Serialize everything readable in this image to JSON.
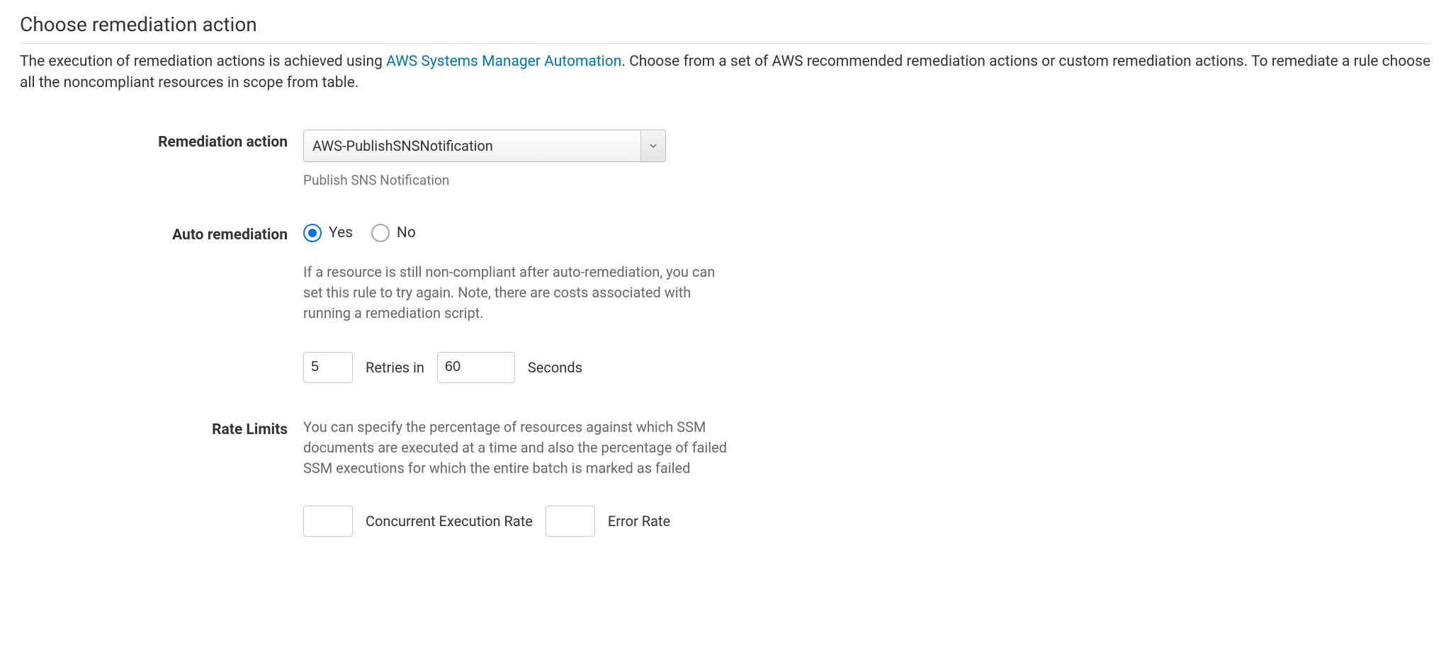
{
  "title": "Choose remediation action",
  "description": {
    "part1": "The execution of remediation actions is achieved using ",
    "link": "AWS Systems Manager Automation",
    "part2": ". Choose from a set of AWS recommended remediation actions or custom remediation actions. To remediate a rule choose all the noncompliant resources in scope from table."
  },
  "remediation": {
    "label": "Remediation action",
    "selected": "AWS-PublishSNSNotification",
    "helper": "Publish SNS Notification"
  },
  "auto": {
    "label": "Auto remediation",
    "yes": "Yes",
    "no": "No",
    "selected": "yes",
    "desc": "If a resource is still non-compliant after auto-remediation, you can set this rule to try again. Note, there are costs associated with running a remediation script.",
    "retries_value": "5",
    "retries_label": "Retries in",
    "seconds_value": "60",
    "seconds_label": "Seconds"
  },
  "rate": {
    "label": "Rate Limits",
    "desc": "You can specify the percentage of resources against which SSM documents are executed at a time and also the percentage of failed SSM executions for which the entire batch is marked as failed",
    "concurrent_value": "",
    "concurrent_label": "Concurrent Execution Rate",
    "error_value": "",
    "error_label": "Error Rate"
  }
}
